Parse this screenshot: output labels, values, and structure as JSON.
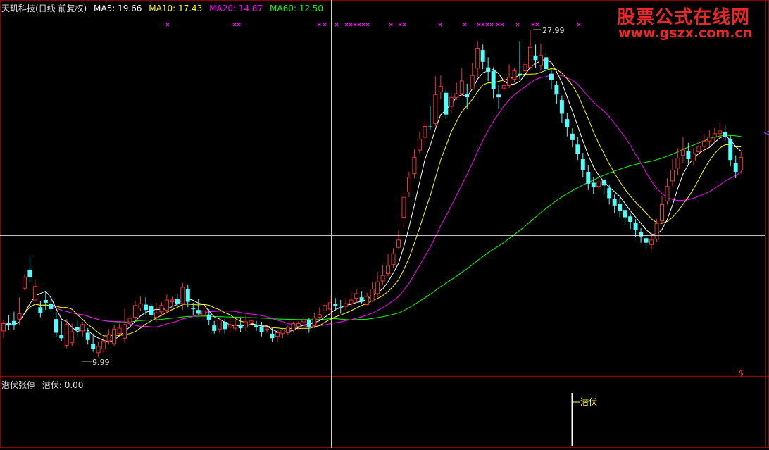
{
  "header": {
    "stock_name": "天玑科技(日线 前复权)",
    "ma5": "MA5: 19.66",
    "ma10": "MA10: 17.43",
    "ma20": "MA20: 14.87",
    "ma60": "MA60: 12.50"
  },
  "sub_header": {
    "indicator_name": "潜伏张停",
    "indicator_value": "潜伏: 0.00"
  },
  "watermark": {
    "line1": "股票公式在线网",
    "line2": "www.gszx.com.cn"
  },
  "colors": {
    "up": "#e8353a",
    "down": "#54fcfc",
    "ma5": "#ffffff",
    "ma10": "#ffff00",
    "ma20": "#ff00ff",
    "ma60": "#00ff00",
    "crosshair": "#ffffff",
    "divider": "#8b0000",
    "marker": "#ff00ff",
    "signal_label": "#ffff66"
  },
  "chart_data": {
    "type": "candlestick",
    "x_axis": "trading days (daily)",
    "y_range": [
      9.2,
      28.8
    ],
    "crosshair_price": 16.7,
    "high_annotation": "27.99",
    "low_annotation": "9.99",
    "signal_label": "潜伏",
    "corner_mark": "$",
    "pos_marker": "<",
    "candles": [
      [
        11.45,
        11.85,
        12.05,
        11.05
      ],
      [
        11.9,
        11.75,
        12.3,
        11.5
      ],
      [
        12.0,
        11.75,
        12.5,
        11.5
      ],
      [
        12.1,
        12.4,
        13.3,
        11.8
      ],
      [
        13.8,
        14.4,
        14.55,
        13.7
      ],
      [
        14.8,
        14.4,
        15.55,
        14.1
      ],
      [
        13.15,
        13.9,
        14.3,
        13.1
      ],
      [
        12.75,
        12.45,
        13.1,
        12.2
      ],
      [
        13.15,
        13.0,
        13.65,
        12.6
      ],
      [
        12.95,
        12.65,
        13.4,
        12.5
      ],
      [
        12.1,
        11.35,
        12.5,
        11.1
      ],
      [
        11.25,
        11.05,
        12.0,
        10.9
      ],
      [
        10.65,
        11.8,
        12.1,
        10.5
      ],
      [
        10.8,
        11.4,
        11.85,
        10.6
      ],
      [
        11.65,
        11.5,
        12.0,
        11.1
      ],
      [
        11.45,
        11.8,
        11.95,
        11.15
      ],
      [
        11.35,
        10.95,
        11.6,
        10.7
      ],
      [
        10.75,
        10.45,
        11.3,
        10.3
      ],
      [
        10.25,
        10.6,
        10.85,
        10.0
      ],
      [
        10.45,
        10.9,
        11.2,
        10.25
      ],
      [
        10.9,
        11.25,
        11.55,
        10.7
      ],
      [
        10.75,
        11.55,
        11.8,
        10.6
      ],
      [
        11.3,
        11.6,
        11.85,
        11.25
      ],
      [
        11.05,
        11.8,
        12.65,
        10.8
      ],
      [
        11.95,
        12.15,
        12.35,
        11.75
      ],
      [
        12.2,
        12.85,
        13.1,
        12.0
      ],
      [
        12.7,
        12.95,
        13.35,
        12.55
      ],
      [
        12.9,
        12.6,
        13.3,
        12.3
      ],
      [
        12.8,
        12.3,
        12.95,
        11.95
      ],
      [
        12.2,
        12.45,
        13.0,
        11.95
      ],
      [
        12.5,
        12.85,
        13.05,
        12.25
      ],
      [
        12.6,
        13.15,
        13.45,
        12.45
      ],
      [
        13.05,
        13.15,
        13.35,
        12.75
      ],
      [
        13.2,
        12.95,
        13.5,
        12.85
      ],
      [
        12.95,
        13.85,
        14.1,
        12.6
      ],
      [
        13.75,
        13.05,
        14.0,
        12.75
      ],
      [
        12.7,
        12.65,
        13.0,
        12.3
      ],
      [
        12.6,
        12.4,
        13.2,
        12.35
      ],
      [
        12.3,
        12.55,
        12.8,
        12.25
      ],
      [
        12.35,
        12.05,
        12.65,
        11.75
      ],
      [
        11.75,
        11.45,
        12.0,
        11.3
      ],
      [
        11.55,
        12.05,
        12.15,
        11.35
      ],
      [
        11.95,
        11.55,
        12.1,
        11.3
      ],
      [
        11.65,
        11.8,
        12.2,
        11.4
      ],
      [
        11.6,
        11.75,
        12.05,
        11.45
      ],
      [
        11.8,
        11.6,
        12.15,
        11.4
      ],
      [
        11.65,
        11.95,
        12.3,
        11.45
      ],
      [
        11.9,
        12.0,
        12.2,
        11.7
      ],
      [
        11.75,
        11.65,
        12.0,
        11.45
      ],
      [
        11.7,
        11.4,
        11.95,
        11.15
      ],
      [
        11.5,
        11.55,
        11.7,
        11.35
      ],
      [
        11.3,
        11.05,
        11.6,
        10.85
      ],
      [
        11.15,
        11.35,
        11.5,
        10.85
      ],
      [
        11.3,
        11.5,
        11.55,
        11.05
      ],
      [
        11.35,
        11.65,
        11.75,
        11.2
      ],
      [
        11.5,
        11.85,
        11.95,
        11.35
      ],
      [
        11.7,
        11.85,
        12.0,
        11.5
      ],
      [
        11.95,
        12.05,
        12.25,
        11.75
      ],
      [
        12.05,
        11.65,
        12.15,
        11.35
      ],
      [
        11.75,
        12.15,
        12.45,
        11.6
      ],
      [
        12.2,
        12.35,
        12.75,
        12.05
      ],
      [
        12.55,
        12.85,
        13.0,
        12.4
      ],
      [
        12.65,
        13.0,
        13.35,
        12.45
      ],
      [
        12.95,
        12.8,
        13.25,
        12.55
      ],
      [
        12.75,
        12.7,
        13.15,
        12.4
      ],
      [
        12.8,
        12.95,
        13.25,
        12.55
      ],
      [
        12.95,
        13.15,
        13.6,
        12.7
      ],
      [
        13.25,
        13.5,
        13.75,
        13.0
      ],
      [
        13.3,
        13.05,
        13.65,
        12.95
      ],
      [
        12.9,
        13.35,
        13.55,
        12.85
      ],
      [
        13.1,
        13.75,
        14.15,
        13.05
      ],
      [
        13.5,
        14.15,
        14.7,
        13.3
      ],
      [
        14.2,
        14.5,
        15.1,
        14.0
      ],
      [
        14.6,
        15.05,
        15.7,
        14.45
      ],
      [
        15.1,
        15.7,
        16.0,
        14.9
      ],
      [
        16.05,
        16.45,
        17.0,
        15.95
      ],
      [
        17.7,
        18.8,
        19.15,
        17.15
      ],
      [
        19.1,
        19.9,
        20.2,
        18.8
      ],
      [
        20.1,
        21.0,
        21.45,
        19.85
      ],
      [
        21.4,
        22.0,
        22.4,
        21.2
      ],
      [
        22.1,
        22.7,
        23.0,
        21.75
      ],
      [
        22.7,
        22.65,
        23.8,
        22.5
      ],
      [
        22.85,
        24.45,
        25.45,
        22.7
      ],
      [
        24.6,
        24.9,
        25.5,
        24.2
      ],
      [
        24.55,
        23.35,
        24.75,
        23.1
      ],
      [
        23.8,
        24.3,
        24.55,
        23.4
      ],
      [
        24.3,
        24.5,
        25.1,
        24.15
      ],
      [
        24.5,
        25.2,
        25.9,
        24.35
      ],
      [
        24.5,
        24.3,
        25.05,
        23.65
      ],
      [
        24.75,
        25.5,
        26.2,
        24.7
      ],
      [
        25.9,
        27.0,
        27.4,
        25.35
      ],
      [
        26.9,
        26.25,
        27.2,
        25.85
      ],
      [
        25.95,
        25.7,
        26.5,
        25.2
      ],
      [
        25.75,
        24.75,
        25.95,
        24.25
      ],
      [
        24.45,
        24.3,
        24.95,
        23.65
      ],
      [
        24.8,
        24.95,
        25.35,
        24.6
      ],
      [
        24.95,
        25.4,
        26.1,
        24.8
      ],
      [
        25.3,
        25.75,
        25.95,
        25.15
      ],
      [
        25.6,
        25.5,
        27.4,
        25.3
      ],
      [
        25.75,
        26.1,
        26.3,
        25.7
      ],
      [
        25.95,
        27.05,
        27.99,
        25.8
      ],
      [
        26.6,
        26.35,
        27.2,
        25.9
      ],
      [
        26.05,
        26.6,
        27.25,
        25.75
      ],
      [
        26.5,
        25.85,
        26.75,
        25.3
      ],
      [
        25.6,
        25.25,
        25.85,
        24.75
      ],
      [
        25.0,
        24.45,
        25.2,
        23.95
      ],
      [
        24.15,
        23.4,
        24.4,
        22.9
      ],
      [
        23.1,
        22.65,
        23.45,
        22.15
      ],
      [
        22.3,
        21.95,
        22.6,
        21.55
      ],
      [
        21.7,
        21.2,
        22.1,
        20.85
      ],
      [
        20.9,
        20.3,
        21.25,
        19.9
      ],
      [
        20.2,
        19.55,
        20.55,
        19.2
      ],
      [
        19.6,
        19.35,
        19.9,
        19.0
      ],
      [
        19.4,
        19.65,
        20.05,
        19.2
      ],
      [
        19.75,
        19.45,
        19.85,
        19.0
      ],
      [
        19.3,
        18.75,
        19.5,
        18.4
      ],
      [
        18.7,
        18.35,
        18.95,
        17.95
      ],
      [
        18.45,
        18.05,
        18.75,
        17.7
      ],
      [
        18.1,
        17.7,
        18.3,
        17.3
      ],
      [
        17.75,
        17.45,
        17.9,
        17.05
      ],
      [
        17.4,
        17.0,
        17.6,
        16.6
      ],
      [
        16.9,
        16.65,
        17.1,
        16.3
      ],
      [
        16.55,
        16.3,
        16.7,
        15.95
      ],
      [
        16.2,
        16.45,
        16.85,
        15.95
      ],
      [
        16.5,
        17.35,
        17.6,
        16.35
      ],
      [
        17.5,
        18.4,
        18.9,
        17.4
      ],
      [
        18.6,
        19.4,
        19.85,
        18.4
      ],
      [
        19.7,
        20.3,
        20.9,
        19.4
      ],
      [
        20.4,
        20.95,
        21.5,
        20.0
      ],
      [
        21.1,
        21.4,
        22.1,
        20.7
      ],
      [
        21.35,
        20.9,
        21.8,
        20.6
      ],
      [
        20.8,
        21.2,
        21.5,
        20.55
      ],
      [
        21.3,
        21.6,
        22.0,
        21.0
      ],
      [
        21.6,
        21.9,
        22.3,
        21.25
      ],
      [
        21.9,
        22.1,
        22.5,
        21.6
      ],
      [
        22.1,
        22.3,
        22.6,
        21.8
      ],
      [
        22.3,
        22.45,
        22.9,
        22.0
      ],
      [
        22.4,
        22.15,
        22.8,
        21.9
      ],
      [
        22.0,
        20.85,
        22.2,
        20.5
      ],
      [
        20.7,
        20.2,
        21.1,
        19.85
      ],
      [
        20.3,
        21.0,
        21.3,
        20.1
      ]
    ]
  }
}
